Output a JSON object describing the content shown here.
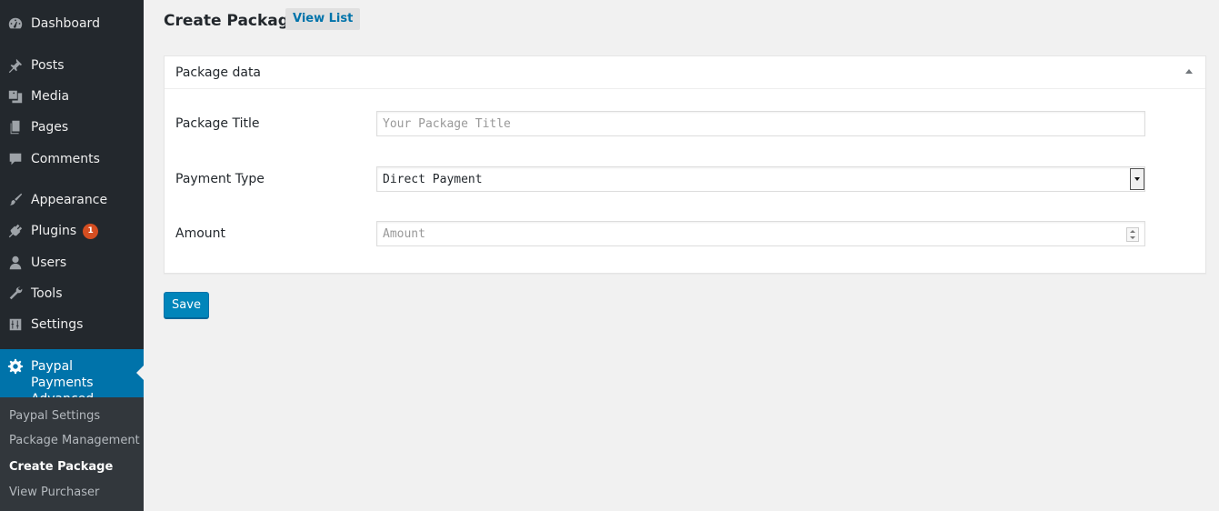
{
  "sidebar": {
    "items": [
      {
        "label": "Dashboard",
        "icon": "dashboard-icon"
      },
      {
        "label": "Posts",
        "icon": "pin-icon"
      },
      {
        "label": "Media",
        "icon": "media-icon"
      },
      {
        "label": "Pages",
        "icon": "pages-icon"
      },
      {
        "label": "Comments",
        "icon": "comment-icon"
      },
      {
        "label": "Appearance",
        "icon": "brush-icon"
      },
      {
        "label": "Plugins",
        "icon": "plugin-icon",
        "badge": "1"
      },
      {
        "label": "Users",
        "icon": "user-icon"
      },
      {
        "label": "Tools",
        "icon": "wrench-icon"
      },
      {
        "label": "Settings",
        "icon": "settings-icon"
      }
    ],
    "current": {
      "label": "Paypal Payments Advanced",
      "icon": "gear-icon"
    },
    "submenu": [
      {
        "label": "Paypal Settings"
      },
      {
        "label": "Package Management"
      },
      {
        "label": "Create Package",
        "current": true
      },
      {
        "label": "View Purchaser"
      }
    ]
  },
  "header": {
    "title": "Create Package",
    "view_list": "View List"
  },
  "postbox": {
    "title": "Package data",
    "fields": {
      "title": {
        "label": "Package Title",
        "placeholder": "Your Package Title"
      },
      "payment_type": {
        "label": "Payment Type",
        "value": "Direct Payment"
      },
      "amount": {
        "label": "Amount",
        "placeholder": "Amount"
      }
    }
  },
  "actions": {
    "save": "Save"
  },
  "colors": {
    "sidebar_bg": "#23282d",
    "accent": "#0073aa",
    "badge": "#d54e21",
    "button": "#0085ba"
  }
}
